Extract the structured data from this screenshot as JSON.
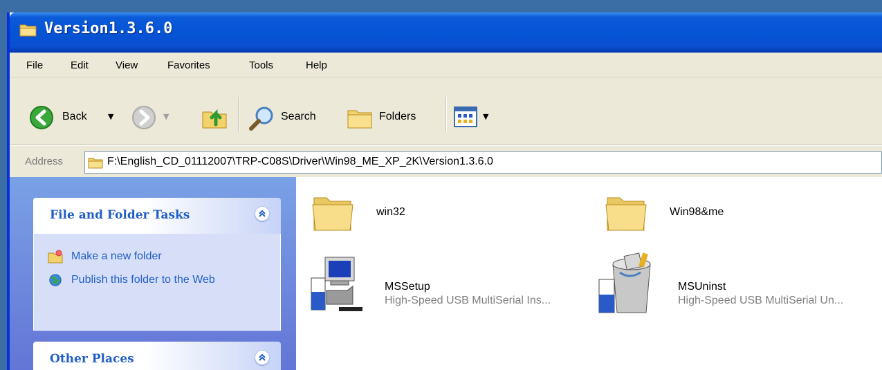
{
  "window": {
    "title": "Version1.3.6.0"
  },
  "menu": [
    "File",
    "Edit",
    "View",
    "Favorites",
    "Tools",
    "Help"
  ],
  "toolbar": {
    "back": "Back",
    "search": "Search",
    "folders": "Folders"
  },
  "address": {
    "label": "Address",
    "path": "F:\\English_CD_01112007\\TRP-C08S\\Driver\\Win98_ME_XP_2K\\Version1.3.6.0"
  },
  "tasks_panel": {
    "title": "File and Folder Tasks",
    "items": [
      {
        "label": "Make a new folder",
        "icon": "new-folder-icon"
      },
      {
        "label": "Publish this folder to the Web",
        "icon": "publish-web-icon"
      }
    ]
  },
  "places_panel": {
    "title": "Other Places"
  },
  "files": [
    {
      "name": "win32",
      "type": "folder"
    },
    {
      "name": "Win98&me",
      "type": "folder"
    },
    {
      "name": "MSSetup",
      "desc": "High-Speed USB MultiSerial Ins...",
      "type": "installer"
    },
    {
      "name": "MSUninst",
      "desc": "High-Speed USB MultiSerial Un...",
      "type": "uninstaller"
    }
  ],
  "colors": {
    "titlebar": "#0554d6",
    "pane": "#7aa1e6",
    "link": "#215dc6",
    "chrome": "#ece9d8"
  }
}
